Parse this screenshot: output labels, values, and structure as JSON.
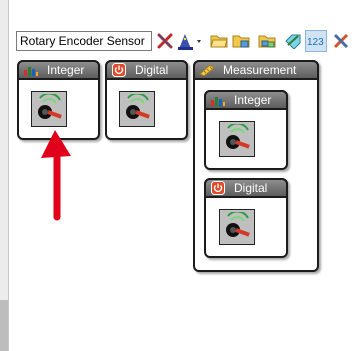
{
  "toolbar": {
    "search_value": "Rotary Encoder Sensor",
    "icons": [
      "close-x-icon",
      "wizard-hat-icon",
      "folder-open-icon",
      "folder-copy-icon",
      "folder-stack-icon",
      "tag-edit-icon",
      "number-123-icon",
      "tools-icon"
    ]
  },
  "panels": {
    "integer": {
      "title": "Integer",
      "icon": "integer-bars-icon"
    },
    "digital": {
      "title": "Digital",
      "icon": "digital-power-icon"
    },
    "measurement": {
      "title": "Measurement",
      "icon": "ruler-icon"
    },
    "measurement_integer": {
      "title": "Integer",
      "icon": "integer-bars-icon"
    },
    "measurement_digital": {
      "title": "Digital",
      "icon": "digital-power-icon"
    }
  },
  "tiles": {
    "icon": "rotary-encoder-sensor-icon"
  },
  "annotation": {
    "arrow_color": "#e0001b",
    "icon": "red-arrow-annotation"
  },
  "colors": {
    "header_bg": "#6f6f6f",
    "panel_border": "#1c1c1c",
    "arrow": "#e0001b"
  }
}
